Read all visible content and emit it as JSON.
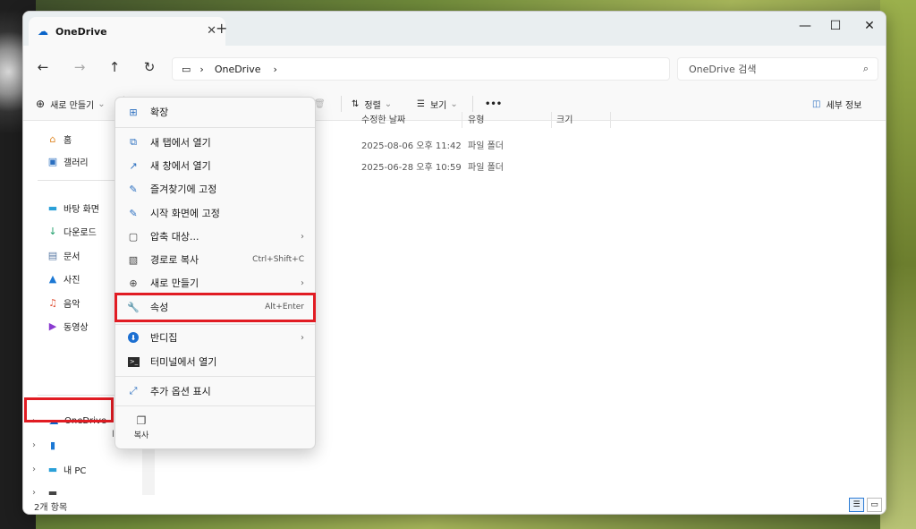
{
  "window": {
    "tab_title": "OneDrive",
    "close_symbol": "✕",
    "new_tab_symbol": "+",
    "minimize_symbol": "—",
    "maximize_symbol": "☐",
    "close_window_symbol": "✕"
  },
  "nav": {
    "back": "←",
    "forward": "→",
    "up": "↑",
    "refresh": "↻",
    "breadcrumb_sep": "›",
    "breadcrumb_item": "OneDrive",
    "breadcrumb_end": "›",
    "search_placeholder": "OneDrive 검색"
  },
  "toolbar": {
    "new_label": "새로 만들기",
    "sort_label": "정렬",
    "view_label": "보기",
    "more_label": "•••",
    "details_label": "세부 정보"
  },
  "sidebar": {
    "items": [
      {
        "label": "홈",
        "icon": "home-icon"
      },
      {
        "label": "갤러리",
        "icon": "gallery-icon"
      },
      {
        "label": "바탕 화면",
        "icon": "desktop-icon"
      },
      {
        "label": "다운로드",
        "icon": "download-icon"
      },
      {
        "label": "문서",
        "icon": "documents-icon"
      },
      {
        "label": "사진",
        "icon": "pictures-icon"
      },
      {
        "label": "음악",
        "icon": "music-icon"
      },
      {
        "label": "동영상",
        "icon": "videos-icon"
      }
    ],
    "tree": [
      {
        "label": "OneDrive",
        "icon": "onedrive-icon"
      },
      {
        "label": "",
        "icon": "phone-icon"
      },
      {
        "label": "내 PC",
        "icon": "pc-icon"
      },
      {
        "label": "",
        "icon": "drive-icon"
      }
    ]
  },
  "content": {
    "columns": [
      "수정한 날짜",
      "유형",
      "크기"
    ],
    "rows": [
      {
        "modified": "2025-08-06 오후 11:42",
        "type": "파일 폴더"
      },
      {
        "modified": "2025-06-28 오후 10:59",
        "type": "파일 폴더"
      }
    ],
    "partial_text": "l"
  },
  "status": {
    "item_count": "2개 항목"
  },
  "context_menu": {
    "items": [
      {
        "label": "확장",
        "icon": "expand-icon"
      },
      {
        "label": "새 탭에서 열기",
        "icon": "open-new-tab-icon"
      },
      {
        "label": "새 창에서 열기",
        "icon": "open-new-window-icon"
      },
      {
        "label": "즐겨찾기에 고정",
        "icon": "pin-icon"
      },
      {
        "label": "시작 화면에 고정",
        "icon": "pin-start-icon"
      },
      {
        "label": "압축 대상...",
        "icon": "compress-icon"
      },
      {
        "label": "경로로 복사",
        "icon": "copy-path-icon",
        "shortcut": "Ctrl+Shift+C"
      },
      {
        "label": "새로 만들기",
        "icon": "new-icon"
      },
      {
        "label": "속성",
        "icon": "properties-icon",
        "shortcut": "Alt+Enter"
      },
      {
        "label": "반디집",
        "icon": "bandizip-icon"
      },
      {
        "label": "터미널에서 열기",
        "icon": "terminal-icon"
      },
      {
        "label": "추가 옵션 표시",
        "icon": "more-options-icon"
      }
    ],
    "copy_label": "복사",
    "submenu_arrow": "›"
  },
  "colors": {
    "highlight": "#e11c23",
    "accent": "#2b6fc0"
  }
}
